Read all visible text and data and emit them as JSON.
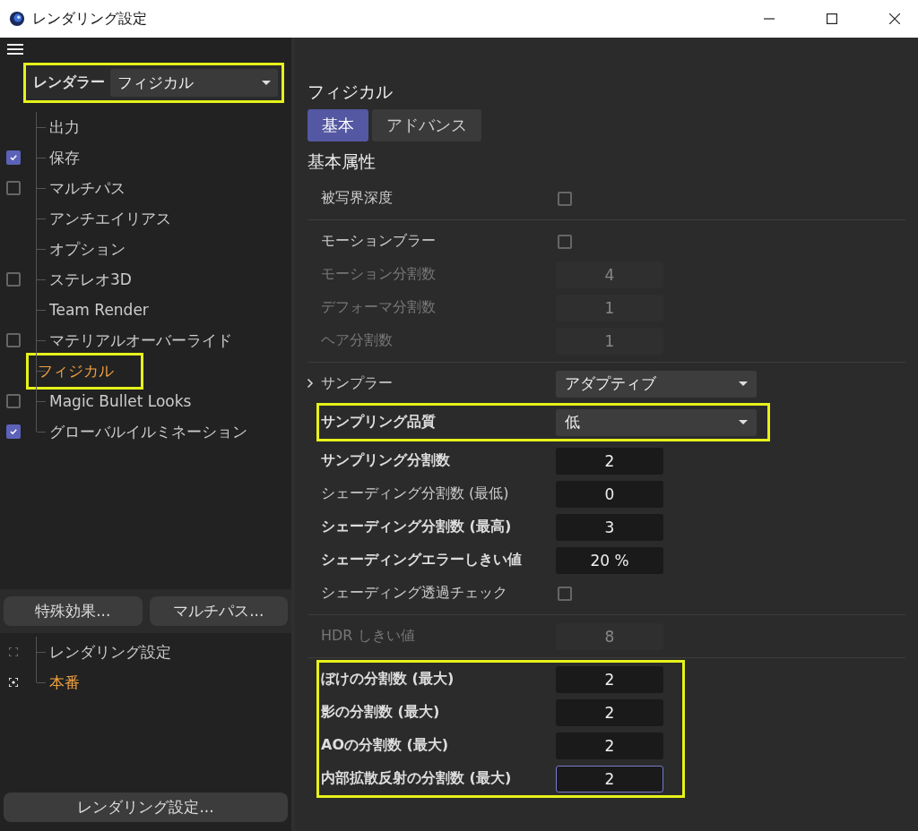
{
  "window": {
    "title": "レンダリング設定"
  },
  "renderer": {
    "label": "レンダラー",
    "value": "フィジカル",
    "highlighted": true
  },
  "tree": [
    {
      "label": "出力",
      "kind": "plain",
      "selected": false,
      "highlighted": false
    },
    {
      "label": "保存",
      "kind": "checkbox",
      "checked": true,
      "selected": false,
      "highlighted": false
    },
    {
      "label": "マルチパス",
      "kind": "checkbox",
      "checked": false,
      "selected": false,
      "highlighted": false
    },
    {
      "label": "アンチエイリアス",
      "kind": "plain",
      "selected": false,
      "highlighted": false
    },
    {
      "label": "オプション",
      "kind": "plain",
      "selected": false,
      "highlighted": false
    },
    {
      "label": "ステレオ3D",
      "kind": "checkbox",
      "checked": false,
      "selected": false,
      "highlighted": false
    },
    {
      "label": "Team Render",
      "kind": "plain",
      "selected": false,
      "highlighted": false
    },
    {
      "label": "マテリアルオーバーライド",
      "kind": "checkbox",
      "checked": false,
      "selected": false,
      "highlighted": false
    },
    {
      "label": "フィジカル",
      "kind": "plain",
      "selected": true,
      "highlighted": true
    },
    {
      "label": "Magic Bullet Looks",
      "kind": "checkbox",
      "checked": false,
      "selected": false,
      "highlighted": false
    },
    {
      "label": "グローバルイルミネーション",
      "kind": "checkbox",
      "checked": true,
      "selected": false,
      "highlighted": false
    }
  ],
  "left_buttons": [
    "特殊効果...",
    "マルチパス..."
  ],
  "presets": [
    {
      "label": "レンダリング設定",
      "selected": false
    },
    {
      "label": "本番",
      "selected": true
    }
  ],
  "bottom_button": "レンダリング設定...",
  "panel": {
    "title": "フィジカル",
    "tabs": [
      {
        "label": "基本",
        "selected": true
      },
      {
        "label": "アドバンス",
        "selected": false
      }
    ],
    "section_title": "基本属性",
    "sections": [
      {
        "groups": [
          {
            "highlighted": false,
            "rows": [
              {
                "kind": "checkbox",
                "label": "被写界深度",
                "checked": false,
                "disabled": false,
                "modified": false
              }
            ]
          }
        ]
      },
      {
        "groups": [
          {
            "highlighted": false,
            "rows": [
              {
                "kind": "checkbox",
                "label": "モーションブラー",
                "checked": false,
                "disabled": false,
                "modified": false
              },
              {
                "kind": "number",
                "label": "モーション分割数",
                "value": "4",
                "disabled": true,
                "modified": false,
                "focused": false
              },
              {
                "kind": "number",
                "label": "デフォーマ分割数",
                "value": "1",
                "disabled": true,
                "modified": false,
                "focused": false
              },
              {
                "kind": "number",
                "label": "ヘア分割数",
                "value": "1",
                "disabled": true,
                "modified": false,
                "focused": false
              }
            ]
          }
        ]
      },
      {
        "groups": [
          {
            "highlighted": false,
            "rows": [
              {
                "kind": "dropdown",
                "label": "サンプラー",
                "value": "アダプティブ",
                "disabled": false,
                "modified": false,
                "expanded": false
              }
            ]
          },
          {
            "highlighted": true,
            "rows": [
              {
                "kind": "dropdown",
                "label": "サンプリング品質",
                "value": "低",
                "disabled": false,
                "modified": true
              }
            ]
          },
          {
            "highlighted": false,
            "rows": [
              {
                "kind": "number",
                "label": "サンプリング分割数",
                "value": "2",
                "disabled": false,
                "modified": true,
                "focused": false
              },
              {
                "kind": "number",
                "label": "シェーディング分割数 (最低)",
                "value": "0",
                "disabled": false,
                "modified": false,
                "focused": false
              },
              {
                "kind": "number",
                "label": "シェーディング分割数 (最高)",
                "value": "3",
                "disabled": false,
                "modified": true,
                "focused": false
              },
              {
                "kind": "number",
                "label": "シェーディングエラーしきい値",
                "value": "20 %",
                "disabled": false,
                "modified": true,
                "focused": false
              },
              {
                "kind": "checkbox",
                "label": "シェーディング透過チェック",
                "checked": false,
                "disabled": false,
                "modified": false
              }
            ]
          }
        ]
      },
      {
        "groups": [
          {
            "highlighted": false,
            "rows": [
              {
                "kind": "number",
                "label": "HDR しきい値",
                "value": "8",
                "disabled": true,
                "modified": false,
                "focused": false
              }
            ]
          }
        ]
      },
      {
        "groups": [
          {
            "highlighted": true,
            "rows": [
              {
                "kind": "number",
                "label": "ぼけの分割数 (最大)",
                "value": "2",
                "disabled": false,
                "modified": true,
                "focused": false
              },
              {
                "kind": "number",
                "label": "影の分割数 (最大)",
                "value": "2",
                "disabled": false,
                "modified": true,
                "focused": false
              },
              {
                "kind": "number",
                "label": "AOの分割数 (最大)",
                "value": "2",
                "disabled": false,
                "modified": true,
                "focused": false
              },
              {
                "kind": "number",
                "label": "内部拡散反射の分割数 (最大)",
                "value": "2",
                "disabled": false,
                "modified": true,
                "focused": true
              }
            ]
          }
        ]
      }
    ]
  }
}
